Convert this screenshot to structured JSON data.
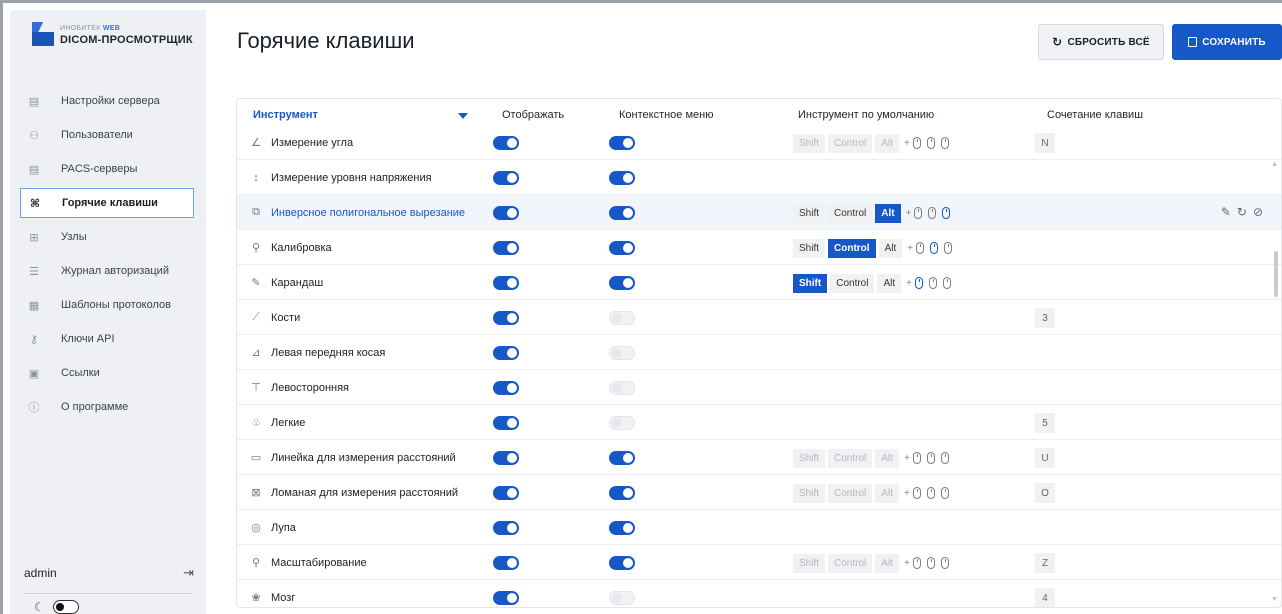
{
  "logo": {
    "top_prefix": "ИНОБИТЕК",
    "top_web": "WEB",
    "main": "DICOM-ПРОСМОТРЩИК"
  },
  "nav": [
    {
      "label": "Настройки сервера",
      "icon": "server-icon",
      "glyph": "▤",
      "active": false
    },
    {
      "label": "Пользователи",
      "icon": "users-icon",
      "glyph": "⚇",
      "active": false
    },
    {
      "label": "PACS-серверы",
      "icon": "pacs-server-icon",
      "glyph": "▤",
      "active": false
    },
    {
      "label": "Горячие клавиши",
      "icon": "hotkeys-icon",
      "glyph": "⌘",
      "active": true
    },
    {
      "label": "Узлы",
      "icon": "nodes-icon",
      "glyph": "⊞",
      "active": false
    },
    {
      "label": "Журнал авторизаций",
      "icon": "log-icon",
      "glyph": "☰",
      "active": false
    },
    {
      "label": "Шаблоны протоколов",
      "icon": "template-icon",
      "glyph": "▦",
      "active": false
    },
    {
      "label": "Ключи API",
      "icon": "key-icon",
      "glyph": "⚷",
      "active": false
    },
    {
      "label": "Ссылки",
      "icon": "link-icon",
      "glyph": "▣",
      "active": false
    },
    {
      "label": "О программе",
      "icon": "info-icon",
      "glyph": "ⓘ",
      "active": false
    }
  ],
  "user": {
    "name": "admin",
    "logout_glyph": "⇥"
  },
  "theme": {
    "glyph": "☾"
  },
  "header": {
    "title": "Горячие клавиши",
    "reset_label": "СБРОСИТЬ ВСЁ",
    "save_label": "СОХРАНИТЬ",
    "reset_glyph": "↻",
    "save_glyph": "💾"
  },
  "table": {
    "columns": {
      "tool": "Инструмент",
      "display": "Отображать",
      "context": "Контекстное меню",
      "default_tool": "Инструмент по умолчанию",
      "hotkey": "Сочетание клавиш"
    },
    "modifier_labels": [
      "Shift",
      "Control",
      "Alt"
    ],
    "plus": "+",
    "rows": [
      {
        "name": "Измерение угла",
        "icon": "angle-icon",
        "glyph": "∠",
        "display": true,
        "context": true,
        "mods": true,
        "mod_sel": null,
        "mouse_sel": null,
        "active": false,
        "hotkey": "N",
        "highlight": false
      },
      {
        "name": "Измерение уровня напряжения",
        "icon": "voltage-icon",
        "glyph": "↕",
        "display": true,
        "context": true,
        "mods": false,
        "hotkey": null,
        "highlight": false
      },
      {
        "name": "Инверсное полигональное вырезание",
        "icon": "polygon-cut-icon",
        "glyph": "⧉",
        "display": true,
        "context": true,
        "mods": true,
        "mod_sel": 2,
        "mouse_sel": 2,
        "active": true,
        "hotkey": null,
        "highlight": true
      },
      {
        "name": "Калибровка",
        "icon": "calibration-icon",
        "glyph": "⚲",
        "display": true,
        "context": true,
        "mods": true,
        "mod_sel": 1,
        "mouse_sel": 1,
        "active": true,
        "hotkey": null,
        "highlight": false
      },
      {
        "name": "Карандаш",
        "icon": "pencil-icon",
        "glyph": "✎",
        "display": true,
        "context": true,
        "mods": true,
        "mod_sel": 0,
        "mouse_sel": 0,
        "active": true,
        "hotkey": null,
        "highlight": false
      },
      {
        "name": "Кости",
        "icon": "bones-icon",
        "glyph": "⟋",
        "display": true,
        "context": false,
        "mods": false,
        "hotkey": "3",
        "highlight": false
      },
      {
        "name": "Левая передняя косая",
        "icon": "lao-icon",
        "glyph": "⊿",
        "display": true,
        "context": false,
        "mods": false,
        "hotkey": null,
        "highlight": false
      },
      {
        "name": "Левосторонняя",
        "icon": "left-lateral-icon",
        "glyph": "⊤",
        "display": true,
        "context": false,
        "mods": false,
        "hotkey": null,
        "highlight": false
      },
      {
        "name": "Легкие",
        "icon": "lungs-icon",
        "glyph": "♧",
        "display": true,
        "context": false,
        "mods": false,
        "hotkey": "5",
        "highlight": false
      },
      {
        "name": "Линейка для измерения расстояний",
        "icon": "ruler-icon",
        "glyph": "▭",
        "display": true,
        "context": true,
        "mods": true,
        "mod_sel": null,
        "mouse_sel": null,
        "active": false,
        "hotkey": "U",
        "highlight": false
      },
      {
        "name": "Ломаная для измерения расстояний",
        "icon": "polyline-icon",
        "glyph": "⊠",
        "display": true,
        "context": true,
        "mods": true,
        "mod_sel": null,
        "mouse_sel": null,
        "active": false,
        "hotkey": "O",
        "highlight": false
      },
      {
        "name": "Лупа",
        "icon": "magnifier-icon",
        "glyph": "◎",
        "display": true,
        "context": true,
        "mods": false,
        "hotkey": null,
        "highlight": false
      },
      {
        "name": "Масштабирование",
        "icon": "zoom-icon",
        "glyph": "⚲",
        "display": true,
        "context": true,
        "mods": true,
        "mod_sel": null,
        "mouse_sel": null,
        "active": false,
        "hotkey": "Z",
        "highlight": false
      },
      {
        "name": "Мозг",
        "icon": "brain-icon",
        "glyph": "❀",
        "display": true,
        "context": false,
        "mods": false,
        "hotkey": "4",
        "highlight": false
      }
    ],
    "row_actions": [
      "✎",
      "↻",
      "⊘"
    ]
  },
  "colors": {
    "accent": "#1658c7",
    "sidebar_bg": "#eef0f3",
    "highlight_row": "#f2f5fb"
  }
}
